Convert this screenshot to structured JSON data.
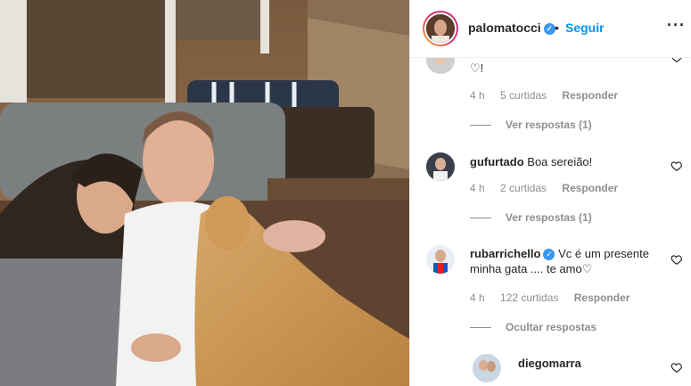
{
  "header": {
    "username": "palomatocci",
    "separator": "•",
    "follow_label": "Seguir",
    "more_label": "···"
  },
  "comments": [
    {
      "text": "♡!",
      "time": "4 h",
      "likes": "5 curtidas",
      "reply": "Responder",
      "view_replies": "Ver respostas (1)"
    },
    {
      "user": "gufurtado",
      "text": "Boa sereião!",
      "time": "4 h",
      "likes": "2 curtidas",
      "reply": "Responder",
      "view_replies": "Ver respostas (1)"
    },
    {
      "user": "rubarrichello",
      "text_line1": "Vc é um presente",
      "text_line2": "minha gata .... te amo♡",
      "time": "4 h",
      "likes": "122 curtidas",
      "reply": "Responder",
      "hide_replies": "Ocultar respostas"
    },
    {
      "user": "diegomarra"
    }
  ],
  "colors": {
    "link": "#0095f6",
    "verified": "#3897f0",
    "muted": "#8e8e8e"
  }
}
